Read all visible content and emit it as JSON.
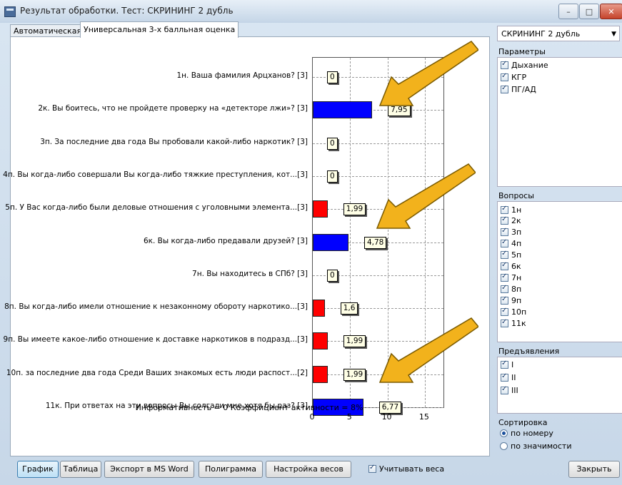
{
  "window": {
    "title": "Результат обработки. Тест: СКРИНИНГ 2 дубль"
  },
  "tabs": [
    "Автоматическая",
    "Универсальная 3-х балльная оценка"
  ],
  "chart_data": {
    "type": "bar",
    "orientation": "horizontal",
    "categories": [
      "1н. Ваша фамилия Арцханов? [3]",
      "2к. Вы боитесь, что не пройдете проверку на «детекторе лжи»? [3]",
      "3п. За последние два года Вы пробовали какой-либо наркотик? [3]",
      "4п. Вы когда-либо совершали Вы когда-либо тяжкие преступления, кот...[3]",
      "5п. У Вас когда-либо были деловые отношения с уголовными элемента...[3]",
      "6к. Вы когда-либо предавали друзей? [3]",
      "7н. Вы находитесь в СПб? [3]",
      "8п. Вы когда-либо имели отношение к незаконному обороту наркотико...[3]",
      "9п. Вы имеете какое-либо отношение к доставке наркотиков в подразд...[3]",
      "10п. за последние два года Среди Ваших знакомых есть люди распост...[2]",
      "11к. При ответах на эти вопросы Вы солгали мне хотя бы раз? [3]"
    ],
    "values": [
      0,
      7.95,
      0,
      0,
      1.99,
      4.78,
      0,
      1.6,
      1.99,
      1.99,
      6.77
    ],
    "value_labels": [
      "0",
      "7,95",
      "0",
      "0",
      "1,99",
      "4,78",
      "0",
      "1,6",
      "1,99",
      "1,99",
      "6,77"
    ],
    "bar_colors": [
      "#0000ff",
      "#0000ff",
      "#ff0000",
      "#ff0000",
      "#ff0000",
      "#0000ff",
      "#0000ff",
      "#ff0000",
      "#ff0000",
      "#ff0000",
      "#0000ff"
    ],
    "xlim": [
      0,
      17.5
    ],
    "xticks": [
      "0",
      "5",
      "10",
      "15"
    ],
    "grid": true
  },
  "footer": {
    "info": "Информативность = 0    Коэффициент активности = 8%"
  },
  "right": {
    "test_select": "СКРИНИНГ 2 дубль",
    "params_title": "Параметры",
    "params": [
      "Дыхание",
      "КГР",
      "ПГ/АД"
    ],
    "questions_title": "Вопросы",
    "questions": [
      "1н",
      "2к",
      "3п",
      "4п",
      "5п",
      "6к",
      "7н",
      "8п",
      "9п",
      "10п",
      "11к"
    ],
    "presentations_title": "Предъявления",
    "presentations": [
      "I",
      "II",
      "III"
    ],
    "sort_title": "Сортировка",
    "sort_options": [
      "по номеру",
      "по значимости"
    ]
  },
  "buttons": {
    "graph": "График",
    "table": "Таблица",
    "export": "Экспорт в MS Word",
    "polygram": "Полиграмма",
    "weights_settings": "Настройка весов",
    "use_weights": "Учитывать веса",
    "close": "Закрыть"
  },
  "colors": {
    "arrow": "#f2b21c",
    "blue_bar": "#0000ff",
    "red_bar": "#ff0000"
  }
}
